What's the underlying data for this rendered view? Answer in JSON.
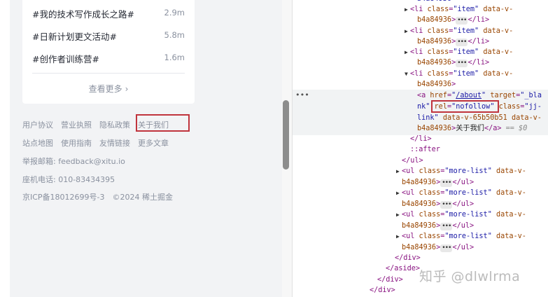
{
  "topics": [
    {
      "name": "#我的技术写作成长之路#",
      "count": "2.9m"
    },
    {
      "name": "#日新计划更文活动#",
      "count": "5.8m"
    },
    {
      "name": "#创作者训练营#",
      "count": "1.6m"
    }
  ],
  "more_label": "查看更多",
  "footer": {
    "row1": [
      "用户协议",
      "营业执照",
      "隐私政策",
      "关于我们"
    ],
    "row2": [
      "站点地图",
      "使用指南",
      "友情链接",
      "更多文章"
    ],
    "report": "举报邮箱: feedback@xitu.io",
    "phone": "座机电话: 010-83434395",
    "icp": "京ICP备18012699号-3",
    "copyright": "©2024 稀土掘金"
  },
  "devtools": {
    "id_suffix": "b4a84936",
    "cut_top": "b4a84936",
    "li_open": "<li class=\"item\" data-v-",
    "li_close": "</li>",
    "a_href": "/about",
    "a_target": "_blank",
    "a_target_part1": "\"_bla",
    "a_target_part2": "nk\"",
    "a_rel": "nofollow",
    "a_class": "jj-link",
    "a_class_part1": "\"jj-",
    "a_class_part2": "link\"",
    "a_dv": "data-v-65b50b51",
    "a_text": "关于我们",
    "eq": "== $0",
    "after": "::after",
    "ul_open": "<ul class=\"more-list\" data-v-",
    "ul_close": "</ul>",
    "closes": [
      "</li>",
      "</ul>",
      "</div>",
      "</aside>",
      "</div>",
      "</div>"
    ]
  },
  "watermark": "知乎 @dlwlrma",
  "colors": {
    "highlight": "#c0343d",
    "page_bg": "#f2f3f5"
  }
}
